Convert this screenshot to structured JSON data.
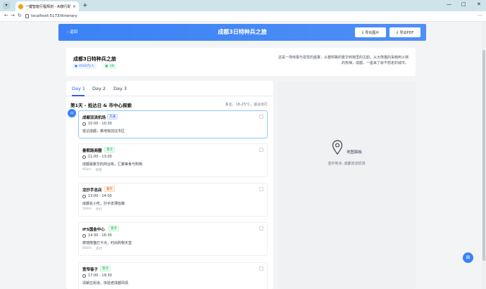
{
  "browser": {
    "tab_title": "一键智能行程规划 - AI旅行助手",
    "url": "localhost:5173/itinerary"
  },
  "header": {
    "back_label": "返回",
    "title": "成都3日特种兵之旅",
    "export_image_label": "导出图片",
    "export_pdf_label": "导出PDF"
  },
  "summary": {
    "title": "成都3日特种兵之旅",
    "budget": "¥500元/人",
    "days": "3天",
    "description": "这是一场味蕾与视觉的盛宴，从春熙路的繁华到锦里的古韵，从大熊猫的呆萌到火锅的热辣，成都，一座来了就不想走的城市。"
  },
  "tabs": [
    "Day 1",
    "Day 2",
    "Day 3"
  ],
  "day": {
    "title": "第1天 - 抵达日 & 市中心探索",
    "weather": "多云，18-25°C，适合出行"
  },
  "stops": [
    {
      "name": "成都双流机场",
      "badge": "交通",
      "time": "10:00 - 10:30",
      "desc": "抵达成都，乘地铁前往市区",
      "meta": []
    },
    {
      "name": "春熙路商圈",
      "badge": "景点",
      "time": "11:00 - 13:00",
      "desc": "成都最繁华的商业街，汇聚美食与购物",
      "meta": [
        "¥5km",
        "地铁"
      ]
    },
    {
      "name": "龙抄手总店",
      "badge": "餐饮",
      "time": "13:00 - 14:00",
      "desc": "成都名小吃，抄手皮薄馅嫩",
      "meta": [
        "500m",
        "步行"
      ]
    },
    {
      "name": "IFS国金中心",
      "badge": "景点",
      "time": "14:30 - 16:30",
      "desc": "爬墙熊猫打卡点，时尚购物天堂",
      "meta": [
        "800m",
        "步行"
      ]
    },
    {
      "name": "宽窄巷子",
      "badge": "景点",
      "time": "17:00 - 19:30",
      "desc": "清朝古街道，体验老成都风情",
      "meta": []
    }
  ],
  "map": {
    "label": "地图面板",
    "subtitle": "选中地点: 成都双流机场"
  }
}
